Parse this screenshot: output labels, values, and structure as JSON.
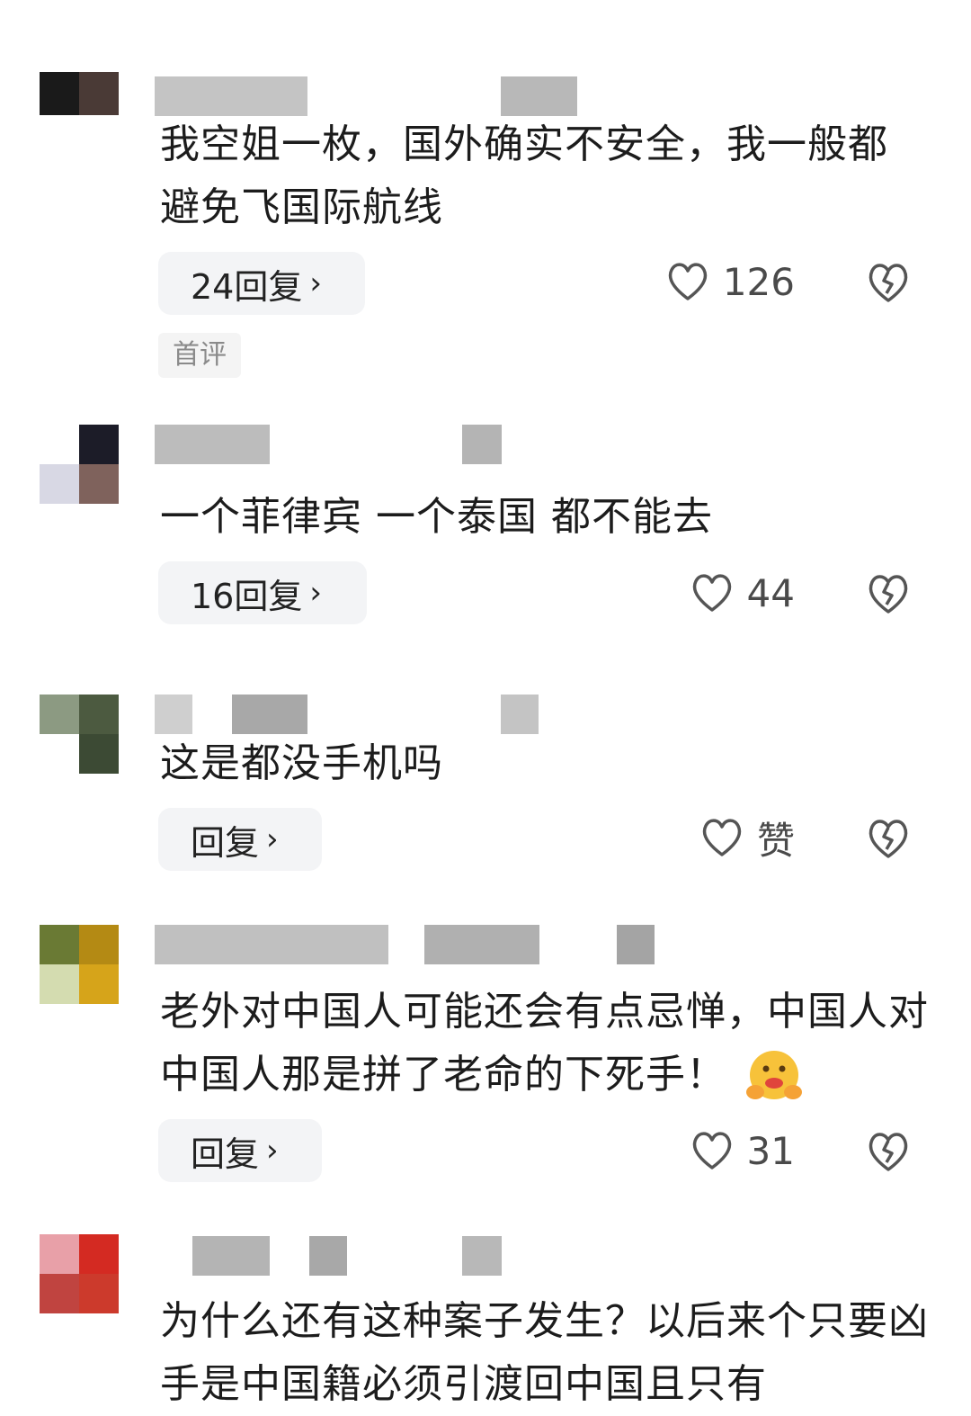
{
  "comments": [
    {
      "text": "我空姐一枚，国外确实不安全，我一般都避免飞国际航线",
      "reply_label": "24回复",
      "like_count": "126",
      "tag": "首评"
    },
    {
      "text": "一个菲律宾 一个泰国 都不能去",
      "reply_label": "16回复",
      "like_count": "44"
    },
    {
      "text": "这是都没手机吗",
      "reply_label": "回复",
      "like_count": "赞"
    },
    {
      "text": "老外对中国人可能还会有点忌惮，中国人对中国人那是拼了老命的下死手！",
      "reply_label": "回复",
      "like_count": "31",
      "emoji": "hug-face-emoji"
    },
    {
      "text": "为什么还有这种案子发生？以后来个只要凶手是中国籍必须引渡回中国且只有"
    }
  ],
  "icons": {
    "chevron": "›",
    "like": "heart-outline-icon",
    "dislike": "broken-heart-icon"
  },
  "colors": {
    "reply_bg": "#f3f4f6",
    "icon": "#555555",
    "text": "#1c1c1c"
  }
}
